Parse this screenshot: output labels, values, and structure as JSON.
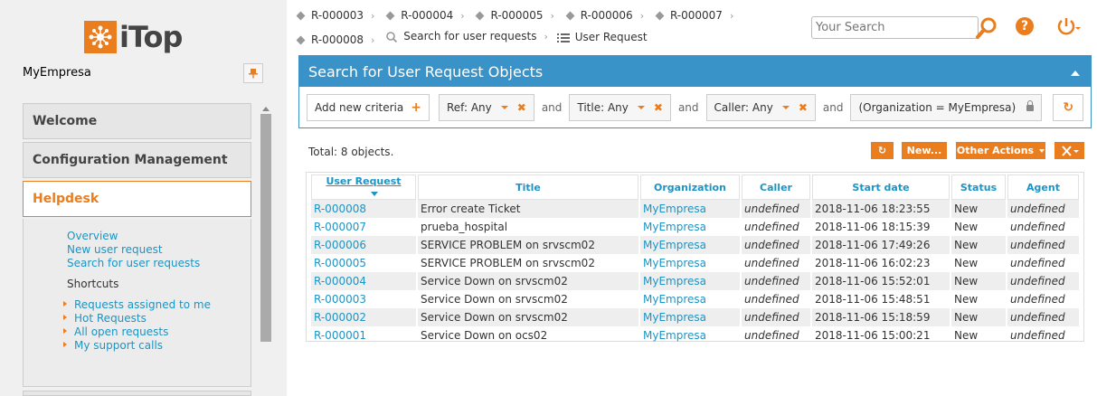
{
  "app": {
    "logo_text": "iTop",
    "org_name": "MyEmpresa"
  },
  "menu": {
    "groups": [
      {
        "label": "Welcome"
      },
      {
        "label": "Configuration Management"
      },
      {
        "label": "Helpdesk"
      }
    ],
    "helpdesk_links": [
      "Overview",
      "New user request",
      "Search for user requests"
    ],
    "shortcuts_label": "Shortcuts",
    "shortcuts": [
      "Requests assigned to me",
      "Hot Requests",
      "All open requests",
      "My support calls"
    ]
  },
  "breadcrumbs": [
    {
      "label": "R-000003",
      "icon": "diamond-icon"
    },
    {
      "label": "R-000004",
      "icon": "diamond-icon"
    },
    {
      "label": "R-000005",
      "icon": "diamond-icon"
    },
    {
      "label": "R-000006",
      "icon": "diamond-icon"
    },
    {
      "label": "R-000007",
      "icon": "diamond-icon"
    },
    {
      "label": "R-000008",
      "icon": "diamond-icon"
    },
    {
      "label": "Search for user requests",
      "icon": "search-icon"
    },
    {
      "label": "User Request",
      "icon": "list-icon"
    }
  ],
  "top": {
    "search_placeholder": "Your Search"
  },
  "search_panel": {
    "title": "Search for User Request Objects",
    "add_criteria": "Add new criteria",
    "criteria": [
      "Ref: Any",
      "Title: Any",
      "Caller: Any"
    ],
    "and_label": "and",
    "locked_criteria": "(Organization = MyEmpresa)"
  },
  "results": {
    "total": "Total: 8 objects.",
    "new_button": "New...",
    "other_actions": "Other Actions",
    "columns": [
      "User Request",
      "Title",
      "Organization",
      "Caller",
      "Start date",
      "Status",
      "Agent"
    ],
    "rows": [
      [
        "R-000008",
        "Error create Ticket",
        "MyEmpresa",
        "undefined",
        "2018-11-06 18:23:55",
        "New",
        "undefined"
      ],
      [
        "R-000007",
        "prueba_hospital",
        "MyEmpresa",
        "undefined",
        "2018-11-06 18:15:39",
        "New",
        "undefined"
      ],
      [
        "R-000006",
        "SERVICE PROBLEM on srvscm02",
        "MyEmpresa",
        "undefined",
        "2018-11-06 17:49:26",
        "New",
        "undefined"
      ],
      [
        "R-000005",
        "SERVICE PROBLEM on srvscm02",
        "MyEmpresa",
        "undefined",
        "2018-11-06 16:02:23",
        "New",
        "undefined"
      ],
      [
        "R-000004",
        "Service Down on srvscm02",
        "MyEmpresa",
        "undefined",
        "2018-11-06 15:52:01",
        "New",
        "undefined"
      ],
      [
        "R-000003",
        "Service Down on srvscm02",
        "MyEmpresa",
        "undefined",
        "2018-11-06 15:48:51",
        "New",
        "undefined"
      ],
      [
        "R-000002",
        "Service Down on srvscm02",
        "MyEmpresa",
        "undefined",
        "2018-11-06 15:18:59",
        "New",
        "undefined"
      ],
      [
        "R-000001",
        "Service Down on ocs02",
        "MyEmpresa",
        "undefined",
        "2018-11-06 15:00:21",
        "New",
        "undefined"
      ]
    ]
  },
  "colors": {
    "accent": "#ea7d1e",
    "panel_blue": "#3a93c8",
    "link": "#1c94c4"
  }
}
